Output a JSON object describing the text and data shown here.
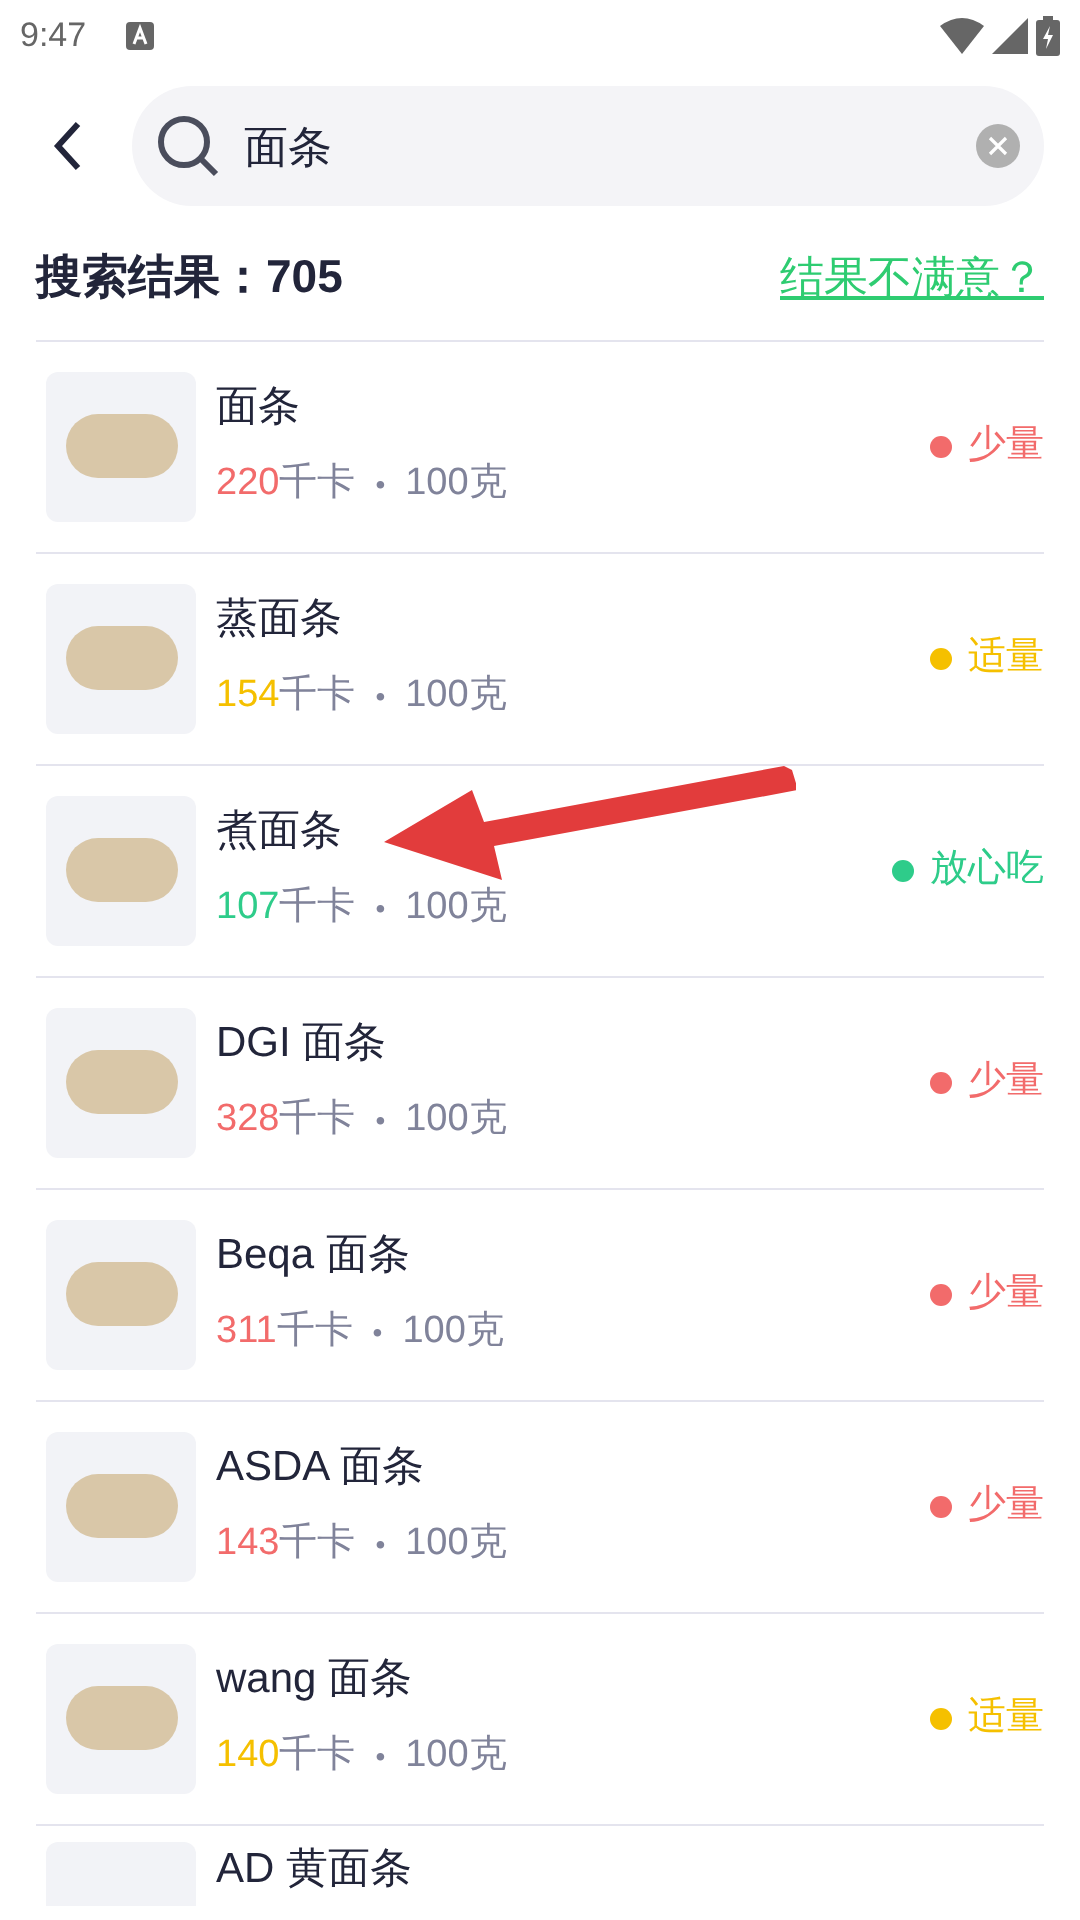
{
  "status_bar": {
    "time": "9:47"
  },
  "search": {
    "value": "面条"
  },
  "results": {
    "label": "搜索结果：",
    "count": "705",
    "feedback_link": "结果不满意？"
  },
  "foods": [
    {
      "name": "面条",
      "kcal": "220",
      "kcal_unit": "千卡",
      "separator": "•",
      "portion": "100克",
      "rating": "少量",
      "color": "#f26b6b"
    },
    {
      "name": "蒸面条",
      "kcal": "154",
      "kcal_unit": "千卡",
      "separator": "•",
      "portion": "100克",
      "rating": "适量",
      "color": "#f5c000"
    },
    {
      "name": "煮面条",
      "kcal": "107",
      "kcal_unit": "千卡",
      "separator": "•",
      "portion": "100克",
      "rating": "放心吃",
      "color": "#2ecc8a"
    },
    {
      "name": "DGI 面条",
      "kcal": "328",
      "kcal_unit": "千卡",
      "separator": "•",
      "portion": "100克",
      "rating": "少量",
      "color": "#f26b6b"
    },
    {
      "name": "Beqa 面条",
      "kcal": "311",
      "kcal_unit": "千卡",
      "separator": "•",
      "portion": "100克",
      "rating": "少量",
      "color": "#f26b6b"
    },
    {
      "name": "ASDA 面条",
      "kcal": "143",
      "kcal_unit": "千卡",
      "separator": "•",
      "portion": "100克",
      "rating": "少量",
      "color": "#f26b6b"
    },
    {
      "name": "wang 面条",
      "kcal": "140",
      "kcal_unit": "千卡",
      "separator": "•",
      "portion": "100克",
      "rating": "适量",
      "color": "#f5c000"
    },
    {
      "name": "AD 黄面条"
    }
  ]
}
